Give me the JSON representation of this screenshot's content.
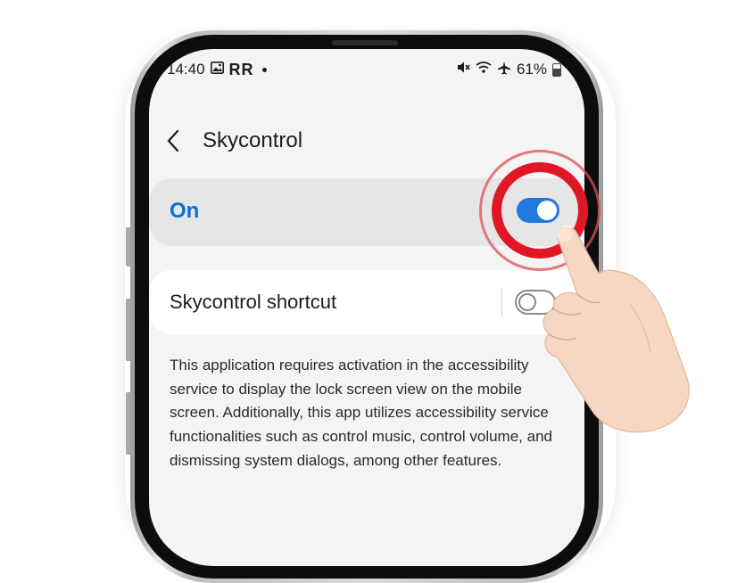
{
  "status_bar": {
    "time": "14:40",
    "rr": "RR",
    "battery": "61%",
    "icons": [
      "image-icon",
      "mute-icon",
      "wifi-icon",
      "airplane-icon",
      "battery-icon"
    ]
  },
  "header": {
    "back_icon": "chevron-left-icon",
    "title": "Skycontrol"
  },
  "main_toggle": {
    "label": "On",
    "state": "on",
    "accent": "#1f7be0"
  },
  "shortcut": {
    "label": "Skycontrol shortcut",
    "state": "off"
  },
  "description": "This application requires activation in the accessibility service to display the lock screen view on the mobile screen. Additionally, this app utilizes accessibility service functionalities such as control music, control volume, and dismissing system dialogs, among other features.",
  "overlay": {
    "ring_color": "#e01825",
    "hand_icon": "pointing-hand-icon"
  }
}
